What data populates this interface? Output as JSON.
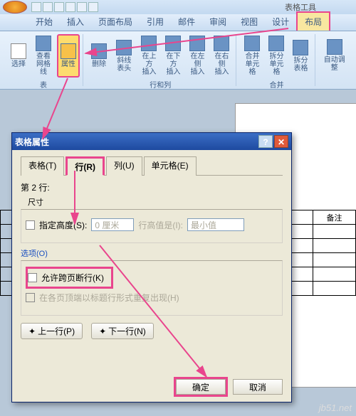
{
  "qat_tool": "表格工具",
  "tabs": {
    "start": "开始",
    "insert": "插入",
    "layout_page": "页面布局",
    "ref": "引用",
    "mail": "邮件",
    "review": "审阅",
    "view": "视图",
    "design": "设计",
    "layout": "布局"
  },
  "ribbon": {
    "select": "选择",
    "gridlines": "查看\n网格线",
    "properties": "属性",
    "delete": "删除",
    "diagonal": "斜线表头",
    "above": "在上方\n插入",
    "below": "在下方\n插入",
    "left": "在左侧\n插入",
    "right": "在右侧\n插入",
    "merge": "合并\n单元格",
    "split": "拆分\n单元格",
    "splittbl": "拆分\n表格",
    "autofit": "自动调整",
    "grp_table": "表",
    "grp_rowcol": "行和列",
    "grp_merge": "合并"
  },
  "bg_table_header": "备注",
  "dialog": {
    "title": "表格属性",
    "tab_table": "表格(T)",
    "tab_row": "行(R)",
    "tab_col": "列(U)",
    "tab_cell": "单元格(E)",
    "rowinfo": "第 2 行:",
    "size": "尺寸",
    "specify_h": "指定高度(S):",
    "h_value": "0 厘米",
    "h_is": "行高值是(I):",
    "h_type": "最小值",
    "options": "选项(O)",
    "allow_break": "允许跨页断行(K)",
    "repeat_header": "在各页顶端以标题行形式重复出现(H)",
    "prev": "上一行(P)",
    "next": "下一行(N)",
    "ok": "确定",
    "cancel": "取消"
  },
  "watermark": "jb51.net"
}
